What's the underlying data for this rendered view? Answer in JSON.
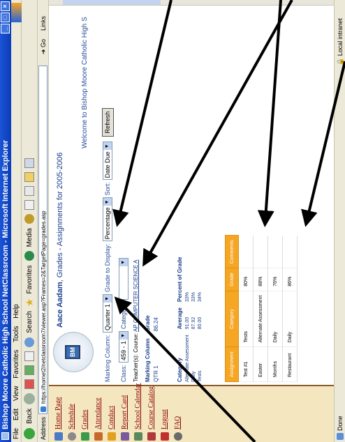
{
  "window": {
    "title": "Bishop Moore Catholic High School NetClassroom - Microsoft Internet Explorer",
    "controls": [
      "_",
      "□",
      "×"
    ]
  },
  "menu": [
    "File",
    "Edit",
    "View",
    "Favorites",
    "Tools",
    "Help"
  ],
  "toolbar": {
    "back": "Back",
    "search": "Search",
    "favorites": "Favorites",
    "media": "Media"
  },
  "address": {
    "label": "Address",
    "url": "https://hornet2/netclassroom7/viewer.asp?Frames=2&TargetPage=grades.asp",
    "go": "Go",
    "links": "Links"
  },
  "nav": [
    {
      "label": "Home Page",
      "icon": "home-icon",
      "color": "#4a7bc8"
    },
    {
      "label": "Schedule",
      "icon": "clock-icon",
      "color": "#8a8a8a"
    },
    {
      "label": "Grades",
      "icon": "pencil-icon",
      "color": "#3a9a4a"
    },
    {
      "label": "Attendance",
      "icon": "people-icon",
      "color": "#c8692a"
    },
    {
      "label": "Conduct",
      "icon": "star-icon",
      "color": "#e0a020"
    },
    {
      "label": "Report Card",
      "icon": "report-icon",
      "color": "#7a5a9a"
    },
    {
      "label": "School Calendar",
      "icon": "calendar-icon",
      "color": "#5a8a5a"
    },
    {
      "label": "Course Catalog",
      "icon": "catalog-icon",
      "color": "#b03a3a"
    },
    {
      "label": "Logout",
      "icon": "exit-icon",
      "color": "#c03030"
    },
    {
      "label": "FAQ",
      "icon": "question-icon",
      "color": "#6a6a6a"
    }
  ],
  "header": {
    "student_name": "Aace Aadam",
    "subtitle": ", Grades - Assignments for 2005-2006",
    "welcome": "Welcome to Bishop Moore Catholic High S",
    "logo_text": "BM"
  },
  "controls": {
    "marking_label": "Marking Column:",
    "marking_value": "Quarter 1",
    "display_label": "Grade to Display:",
    "display_value": "Percentage",
    "sort_label": "Sort:",
    "sort_value": "Date Due",
    "refresh": "Refresh",
    "class_label": "Class:",
    "class_value": "459 - 1",
    "category_label": "Category:",
    "category_value": ""
  },
  "teacher": {
    "label": "Teacher(s):",
    "course_label": "Course:",
    "course": "AP COMPUTER SCIENCE A"
  },
  "marking_table": {
    "headers": [
      "Marking Column",
      "Grade"
    ],
    "rows": [
      [
        "QTR 1",
        "86.24"
      ]
    ]
  },
  "category_table": {
    "headers": [
      "Category",
      "Average",
      "Percent of Grade"
    ],
    "rows": [
      [
        "Alternate Assessment",
        "91.00",
        "33%"
      ],
      [
        "Daily",
        "87.92",
        "33%"
      ],
      [
        "Tests",
        "80.00",
        "34%"
      ]
    ]
  },
  "assignments": {
    "headers": [
      "Assignment",
      "Category",
      "Grade",
      "Comments"
    ],
    "rows": [
      [
        "Test #1",
        "Tests",
        "80%",
        ""
      ],
      [
        "Easter",
        "Alternate Assessment",
        "88%",
        ""
      ],
      [
        "Months",
        "Daily",
        "76%",
        ""
      ],
      [
        "Restaurant",
        "Daily",
        "86%",
        ""
      ]
    ]
  },
  "status": {
    "text": "Done",
    "zone": "Local intranet"
  }
}
